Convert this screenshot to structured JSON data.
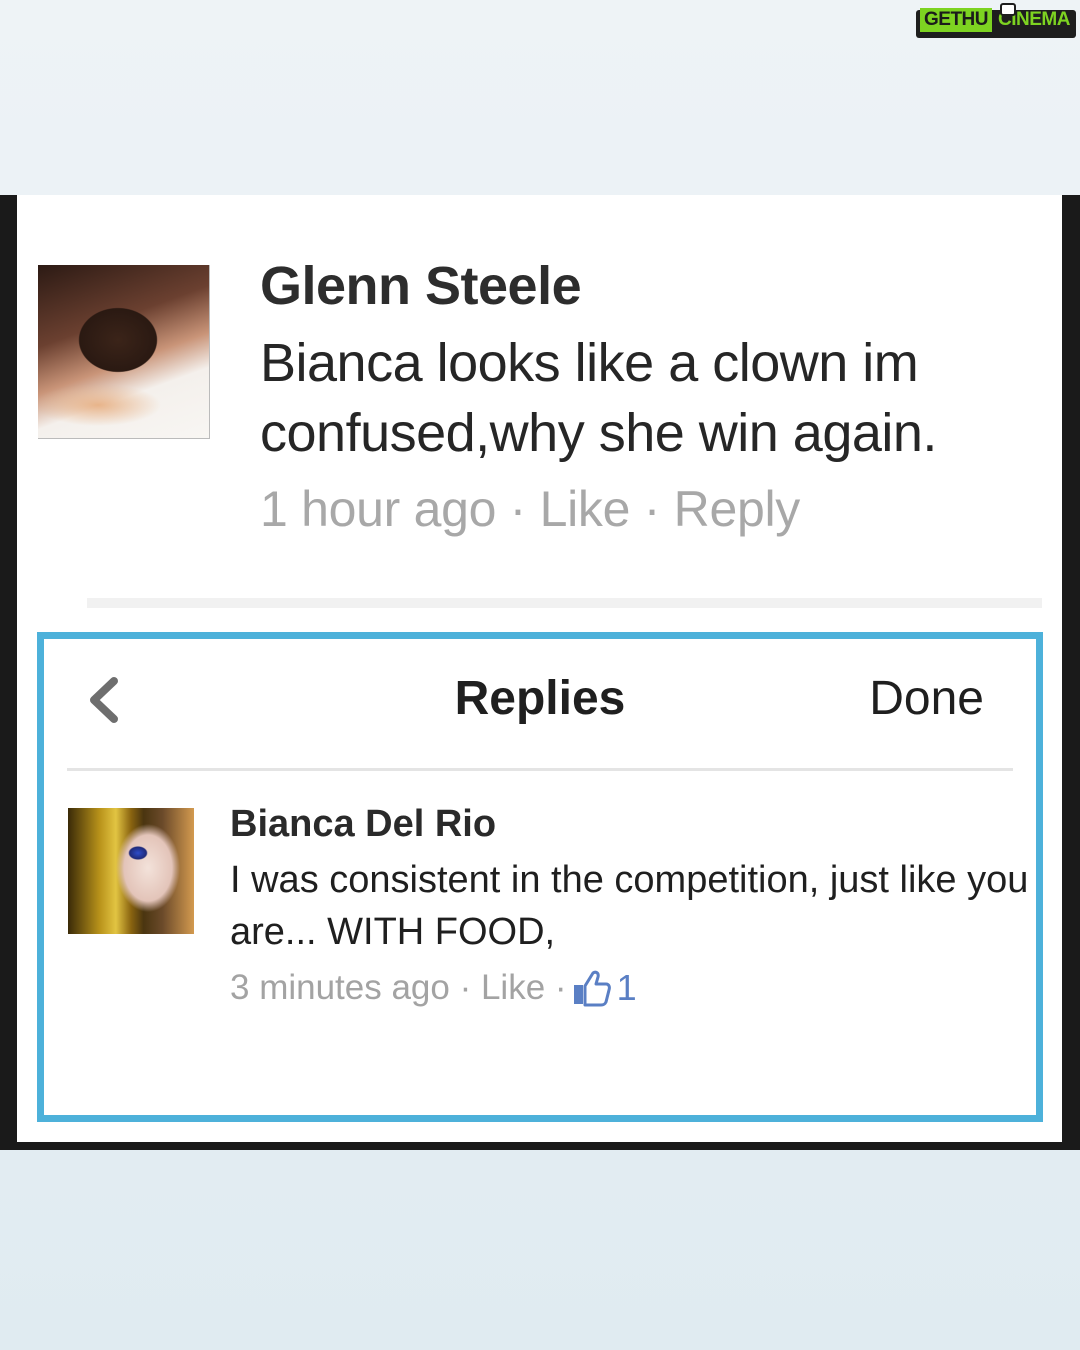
{
  "watermark": {
    "part1": "GETHU",
    "part2": "CINEMA"
  },
  "comment": {
    "author": "Glenn Steele",
    "text": "Bianca looks like a clown im confused,why she win again.",
    "meta": "1 hour ago · Like · Reply"
  },
  "replies_panel": {
    "title": "Replies",
    "done_label": "Done",
    "back_icon": "chevron-left-icon",
    "accent_color": "#4db1da"
  },
  "reply": {
    "author": "Bianca Del Rio",
    "text": "I was consistent in the competition, just like you are... WITH FOOD,",
    "meta": "3 minutes ago · Like · ",
    "like_icon": "thumbs-up-icon",
    "like_count": "1"
  }
}
